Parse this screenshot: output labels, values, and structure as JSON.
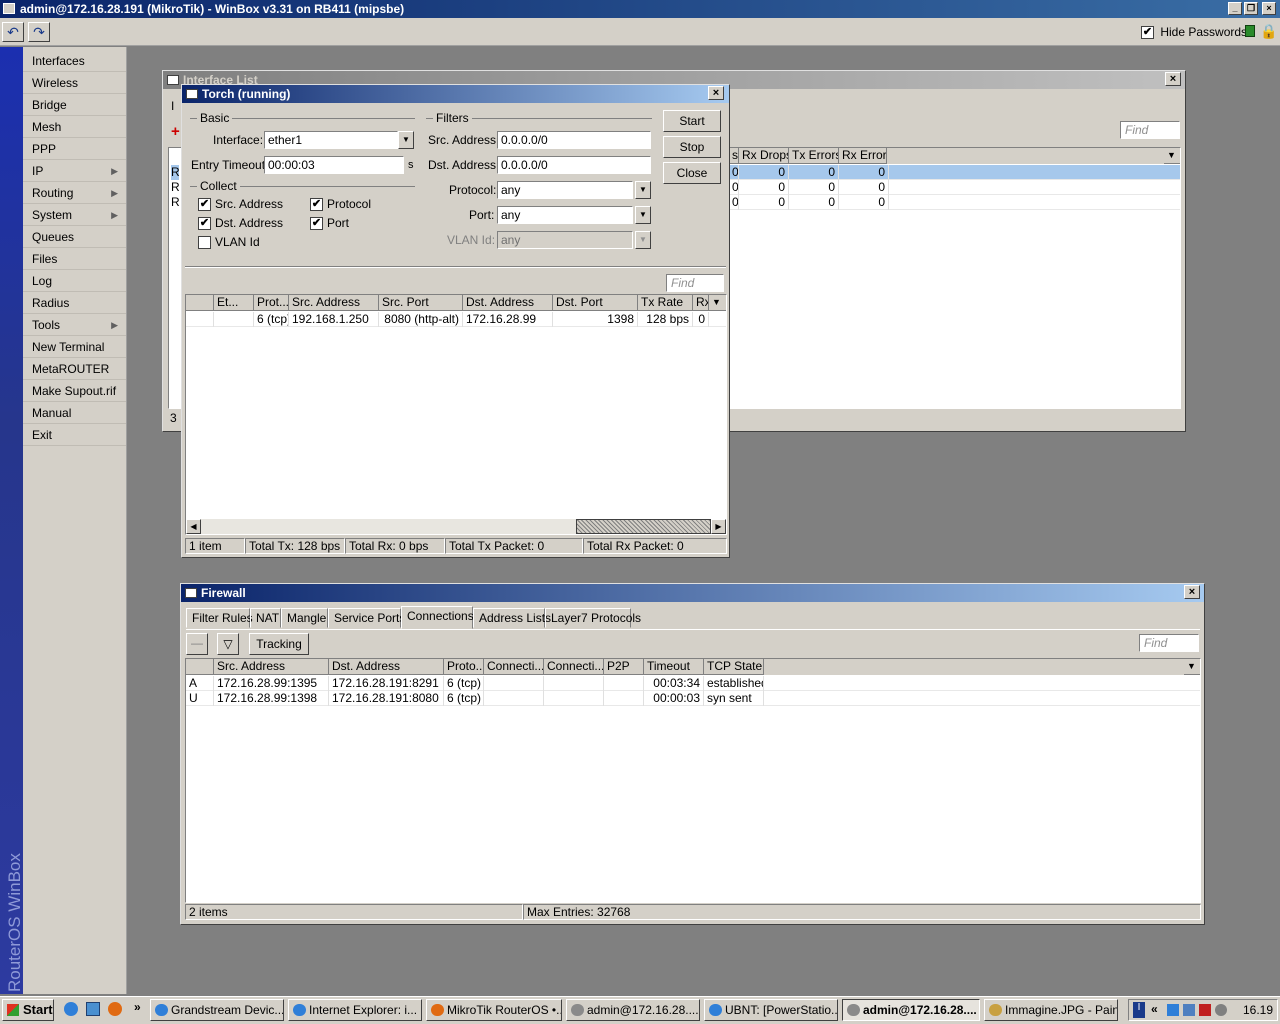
{
  "app": {
    "title": "admin@172.16.28.191 (MikroTik) - WinBox v3.31 on RB411 (mipsbe)",
    "hide_passwords_label": "Hide Passwords",
    "hide_passwords_checked": true,
    "undo_icon": "undo-icon",
    "redo_icon": "redo-icon",
    "lock_icon": "lock-icon",
    "vertical_brand": "RouterOS WinBox"
  },
  "menu": {
    "items": [
      {
        "label": "Interfaces",
        "submenu": false
      },
      {
        "label": "Wireless",
        "submenu": false
      },
      {
        "label": "Bridge",
        "submenu": false
      },
      {
        "label": "Mesh",
        "submenu": false
      },
      {
        "label": "PPP",
        "submenu": false
      },
      {
        "label": "IP",
        "submenu": true
      },
      {
        "label": "Routing",
        "submenu": true
      },
      {
        "label": "System",
        "submenu": true
      },
      {
        "label": "Queues",
        "submenu": false
      },
      {
        "label": "Files",
        "submenu": false
      },
      {
        "label": "Log",
        "submenu": false
      },
      {
        "label": "Radius",
        "submenu": false
      },
      {
        "label": "Tools",
        "submenu": true
      },
      {
        "label": "New Terminal",
        "submenu": false
      },
      {
        "label": "MetaROUTER",
        "submenu": false
      },
      {
        "label": "Make Supout.rif",
        "submenu": false
      },
      {
        "label": "Manual",
        "submenu": false
      },
      {
        "label": "Exit",
        "submenu": false
      }
    ]
  },
  "interface_list": {
    "title": "Interface List",
    "find_placeholder": "Find",
    "columns": [
      "s",
      "Rx Drops",
      "Tx Errors",
      "Rx Errors"
    ],
    "rows": [
      {
        "prefix": "R",
        "c0": "0",
        "c1": "0",
        "c2": "0",
        "c3": "0"
      },
      {
        "prefix": "R",
        "c0": "0",
        "c1": "0",
        "c2": "0",
        "c3": "0"
      },
      {
        "prefix": "R",
        "c0": "0",
        "c1": "0",
        "c2": "0",
        "c3": "0"
      }
    ],
    "status_count": "3"
  },
  "torch": {
    "title": "Torch (running)",
    "basic_label": "Basic",
    "interface_label": "Interface:",
    "interface_value": "ether1",
    "entry_timeout_label": "Entry Timeout:",
    "entry_timeout_value": "00:00:03",
    "entry_timeout_unit": "s",
    "collect_label": "Collect",
    "collect": [
      {
        "label": "Src. Address",
        "checked": true
      },
      {
        "label": "Protocol",
        "checked": true
      },
      {
        "label": "Dst. Address",
        "checked": true
      },
      {
        "label": "Port",
        "checked": true
      },
      {
        "label": "VLAN Id",
        "checked": false
      }
    ],
    "filters_label": "Filters",
    "src_address_label": "Src. Address:",
    "src_address_value": "0.0.0.0/0",
    "dst_address_label": "Dst. Address:",
    "dst_address_value": "0.0.0.0/0",
    "protocol_label": "Protocol:",
    "protocol_value": "any",
    "port_label": "Port:",
    "port_value": "any",
    "vlan_label": "VLAN Id:",
    "vlan_value": "any",
    "start_label": "Start",
    "stop_label": "Stop",
    "close_label": "Close",
    "find_placeholder": "Find",
    "columns": [
      "Et...",
      "Prot...",
      "Src. Address",
      "Src. Port",
      "Dst. Address",
      "Dst. Port",
      "Tx Rate",
      "Rx"
    ],
    "rows": [
      {
        "et": "",
        "prot": "6 (tcp)",
        "src": "192.168.1.250",
        "sport": "8080 (http-alt)",
        "dst": "172.16.28.99",
        "dport": "1398",
        "tx": "128 bps",
        "rx": "0"
      }
    ],
    "status": {
      "items": "1 item",
      "total_tx": "Total Tx: 128 bps",
      "total_rx": "Total Rx: 0 bps",
      "total_tx_packet": "Total Tx Packet: 0",
      "total_rx_packet": "Total Rx Packet: 0"
    }
  },
  "firewall": {
    "title": "Firewall",
    "tabs": [
      "Filter Rules",
      "NAT",
      "Mangle",
      "Service Ports",
      "Connections",
      "Address Lists",
      "Layer7 Protocols"
    ],
    "selected_tab": "Connections",
    "tracking_label": "Tracking",
    "find_placeholder": "Find",
    "columns": [
      "Src. Address",
      "Dst. Address",
      "Proto...",
      "Connecti...",
      "Connecti...",
      "P2P",
      "Timeout",
      "TCP State"
    ],
    "rows": [
      {
        "flag": "A",
        "src": "172.16.28.99:1395",
        "dst": "172.16.28.191:8291",
        "proto": "6 (tcp)",
        "c1": "",
        "c2": "",
        "p2p": "",
        "timeout": "00:03:34",
        "state": "established"
      },
      {
        "flag": "U",
        "src": "172.16.28.99:1398",
        "dst": "172.16.28.191:8080",
        "proto": "6 (tcp)",
        "c1": "",
        "c2": "",
        "p2p": "",
        "timeout": "00:00:03",
        "state": "syn sent"
      }
    ],
    "status_items": "2 items",
    "status_max": "Max Entries: 32768"
  },
  "taskbar": {
    "start_label": "Start",
    "tasks": [
      {
        "label": "Grandstream Devic...",
        "color": "#2f7fd8"
      },
      {
        "label": "Internet Explorer: i...",
        "color": "#2f7fd8"
      },
      {
        "label": "MikroTik RouterOS •...",
        "color": "#e06a12"
      },
      {
        "label": "admin@172.16.28....",
        "color": "#8a8a8a"
      },
      {
        "label": "UBNT: [PowerStatio...",
        "color": "#2f7fd8"
      },
      {
        "label": "admin@172.16.28....",
        "color": "#8a8a8a"
      },
      {
        "label": "Immagine.JPG - Paint",
        "color": "#c8a040"
      }
    ],
    "active_task": 5,
    "clock": "16.19"
  }
}
